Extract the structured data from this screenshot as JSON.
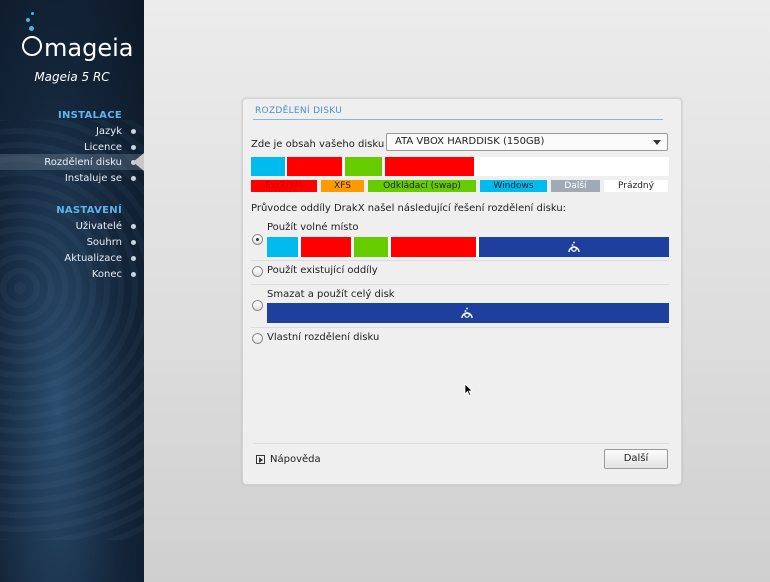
{
  "sidebar": {
    "logo_text": "mageia",
    "version": "Mageia 5 RC",
    "sections": [
      {
        "title": "INSTALACE",
        "items": [
          "Jazyk",
          "Licence",
          "Rozdělení disku",
          "Instaluje se"
        ]
      },
      {
        "title": "NASTAVENÍ",
        "items": [
          "Uživatelé",
          "Souhrn",
          "Aktualizace",
          "Konec"
        ]
      }
    ],
    "active_item": "Rozdělení disku"
  },
  "dialog": {
    "title": "ROZDĚLENÍ DISKU",
    "disk_label": "Zde je obsah vašeho disku",
    "disk_value": "ATA VBOX HARDDISK (150GB)",
    "legend": [
      {
        "label": "Ext2/3/4",
        "color": "#ff0000",
        "text_color": "#cc0000"
      },
      {
        "label": "XFS",
        "color": "#ff9900",
        "text_color": "#222222"
      },
      {
        "label": "Odkládací (swap)",
        "color": "#66cc00",
        "text_color": "#222222"
      },
      {
        "label": "Windows",
        "color": "#00bbee",
        "text_color": "#222222"
      },
      {
        "label": "Další",
        "color": "#a0aab4",
        "text_color": "#ffffff"
      },
      {
        "label": "Prázdný",
        "color": "#ffffff",
        "text_color": "#222222"
      }
    ],
    "hint": "Průvodce oddíly DrakX našel následující řešení rozdělení disku:",
    "options": [
      {
        "label": "Použít volné místo",
        "selected": true
      },
      {
        "label": "Použít existující oddíly",
        "selected": false
      },
      {
        "label": "Smazat a použít celý disk",
        "selected": false
      },
      {
        "label": "Vlastní rozdělení disku",
        "selected": false
      }
    ],
    "help_label": "Nápověda",
    "next_label": "Další"
  },
  "colors": {
    "windows": "#00bbee",
    "ext": "#ff0000",
    "swap": "#66cc00",
    "new_mageia": "#1e3f9e",
    "accent": "#4a8fd0"
  }
}
